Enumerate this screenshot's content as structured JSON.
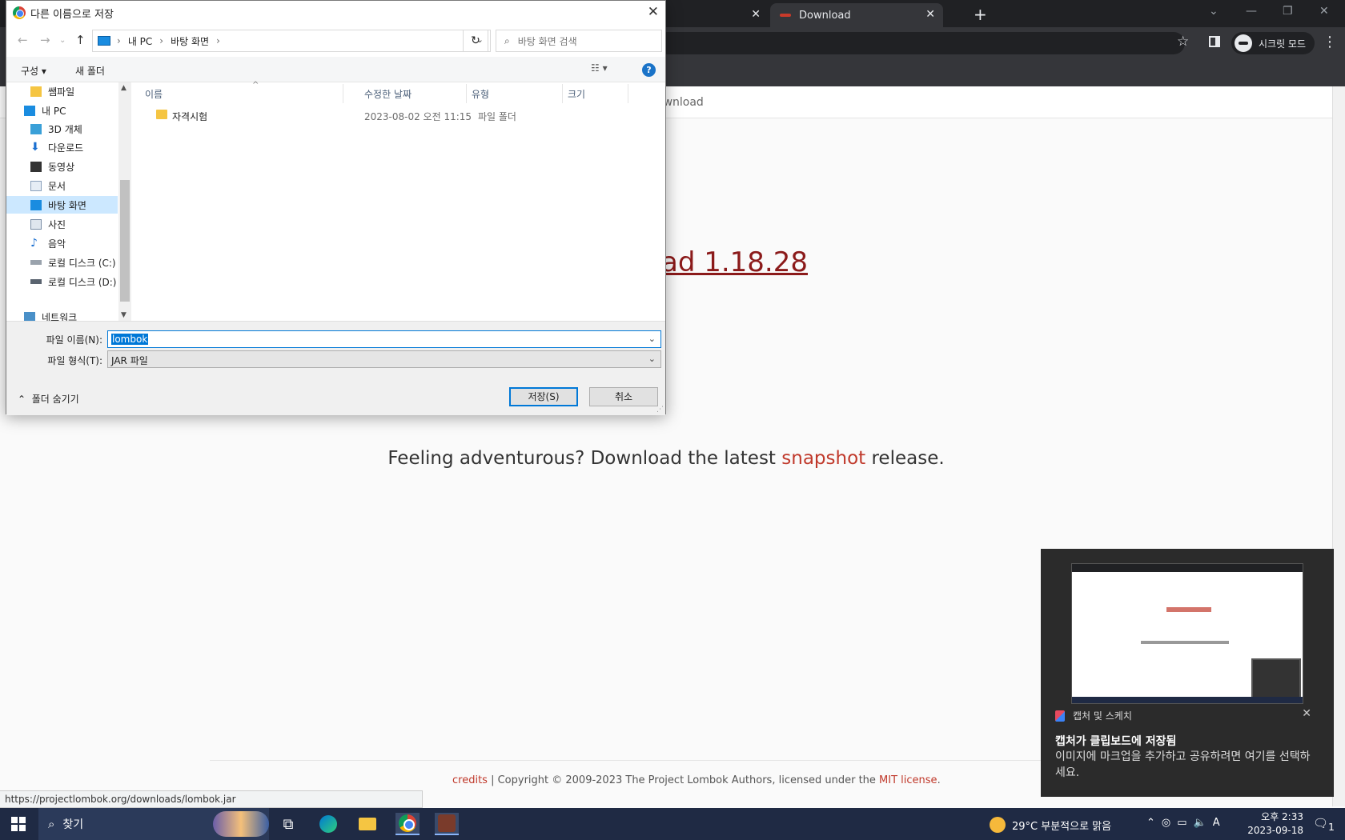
{
  "browser": {
    "tabs": [
      {
        "label": ""
      },
      {
        "label": "Download"
      }
    ],
    "incognito_label": "시크릿 모드",
    "status_url": "https://projectlombok.org/downloads/lombok.jar"
  },
  "page": {
    "nav_label": "ownload",
    "download_heading": "ad 1.18.28",
    "adventure_prefix": "Feeling adventurous? Download the latest ",
    "adventure_link": "snapshot",
    "adventure_suffix": " release.",
    "footer_credits": "credits",
    "footer_middle": " | Copyright © 2009-2023 The Project Lombok Authors, licensed under the ",
    "footer_license": "MIT license",
    "footer_end": "."
  },
  "dialog": {
    "title": "다른 이름으로 저장",
    "breadcrumb": [
      "내 PC",
      "바탕 화면"
    ],
    "search_placeholder": "바탕 화면 검색",
    "organize": "구성 ▾",
    "new_folder": "새 폴더",
    "nav_items": [
      {
        "label": "쌤파일",
        "icon": "folder-icon"
      },
      {
        "label": "내 PC",
        "icon": "pc-icon"
      },
      {
        "label": "3D 개체",
        "icon": "3d-objects-icon"
      },
      {
        "label": "다운로드",
        "icon": "download-icon"
      },
      {
        "label": "동영상",
        "icon": "video-icon"
      },
      {
        "label": "문서",
        "icon": "document-icon"
      },
      {
        "label": "바탕 화면",
        "icon": "desktop-icon"
      },
      {
        "label": "사진",
        "icon": "pictures-icon"
      },
      {
        "label": "음악",
        "icon": "music-icon"
      },
      {
        "label": "로컬 디스크 (C:)",
        "icon": "drive-icon"
      },
      {
        "label": "로컬 디스크 (D:)",
        "icon": "drive-icon"
      },
      {
        "label": "네트워크",
        "icon": "network-icon"
      }
    ],
    "columns": [
      "이름",
      "수정한 날짜",
      "유형",
      "크기"
    ],
    "files": [
      {
        "name": "자격시험",
        "modified": "2023-08-02 오전 11:15",
        "type": "파일 폴더",
        "size": ""
      }
    ],
    "filename_label": "파일 이름(N):",
    "filename_value": "lombok",
    "filetype_label": "파일 형식(T):",
    "filetype_value": "JAR 파일",
    "hide_folders": "폴더 숨기기",
    "save_button": "저장(S)",
    "cancel_button": "취소"
  },
  "toast": {
    "app_name": "캡처 및 스케치",
    "title": "캡처가 클립보드에 저장됨",
    "body": "이미지에 마크업을 추가하고 공유하려면 여기를 선택하세요."
  },
  "taskbar": {
    "search_label": "찾기",
    "weather": "29°C  부분적으로 맑음",
    "ime": "A",
    "time": "오후 2:33",
    "date": "2023-09-18",
    "notification_count": "1"
  },
  "colors": {
    "accent": "#0078d7",
    "link_red": "#c0392b",
    "heading_red": "#8b1a1a",
    "taskbar": "#1f2a44"
  }
}
